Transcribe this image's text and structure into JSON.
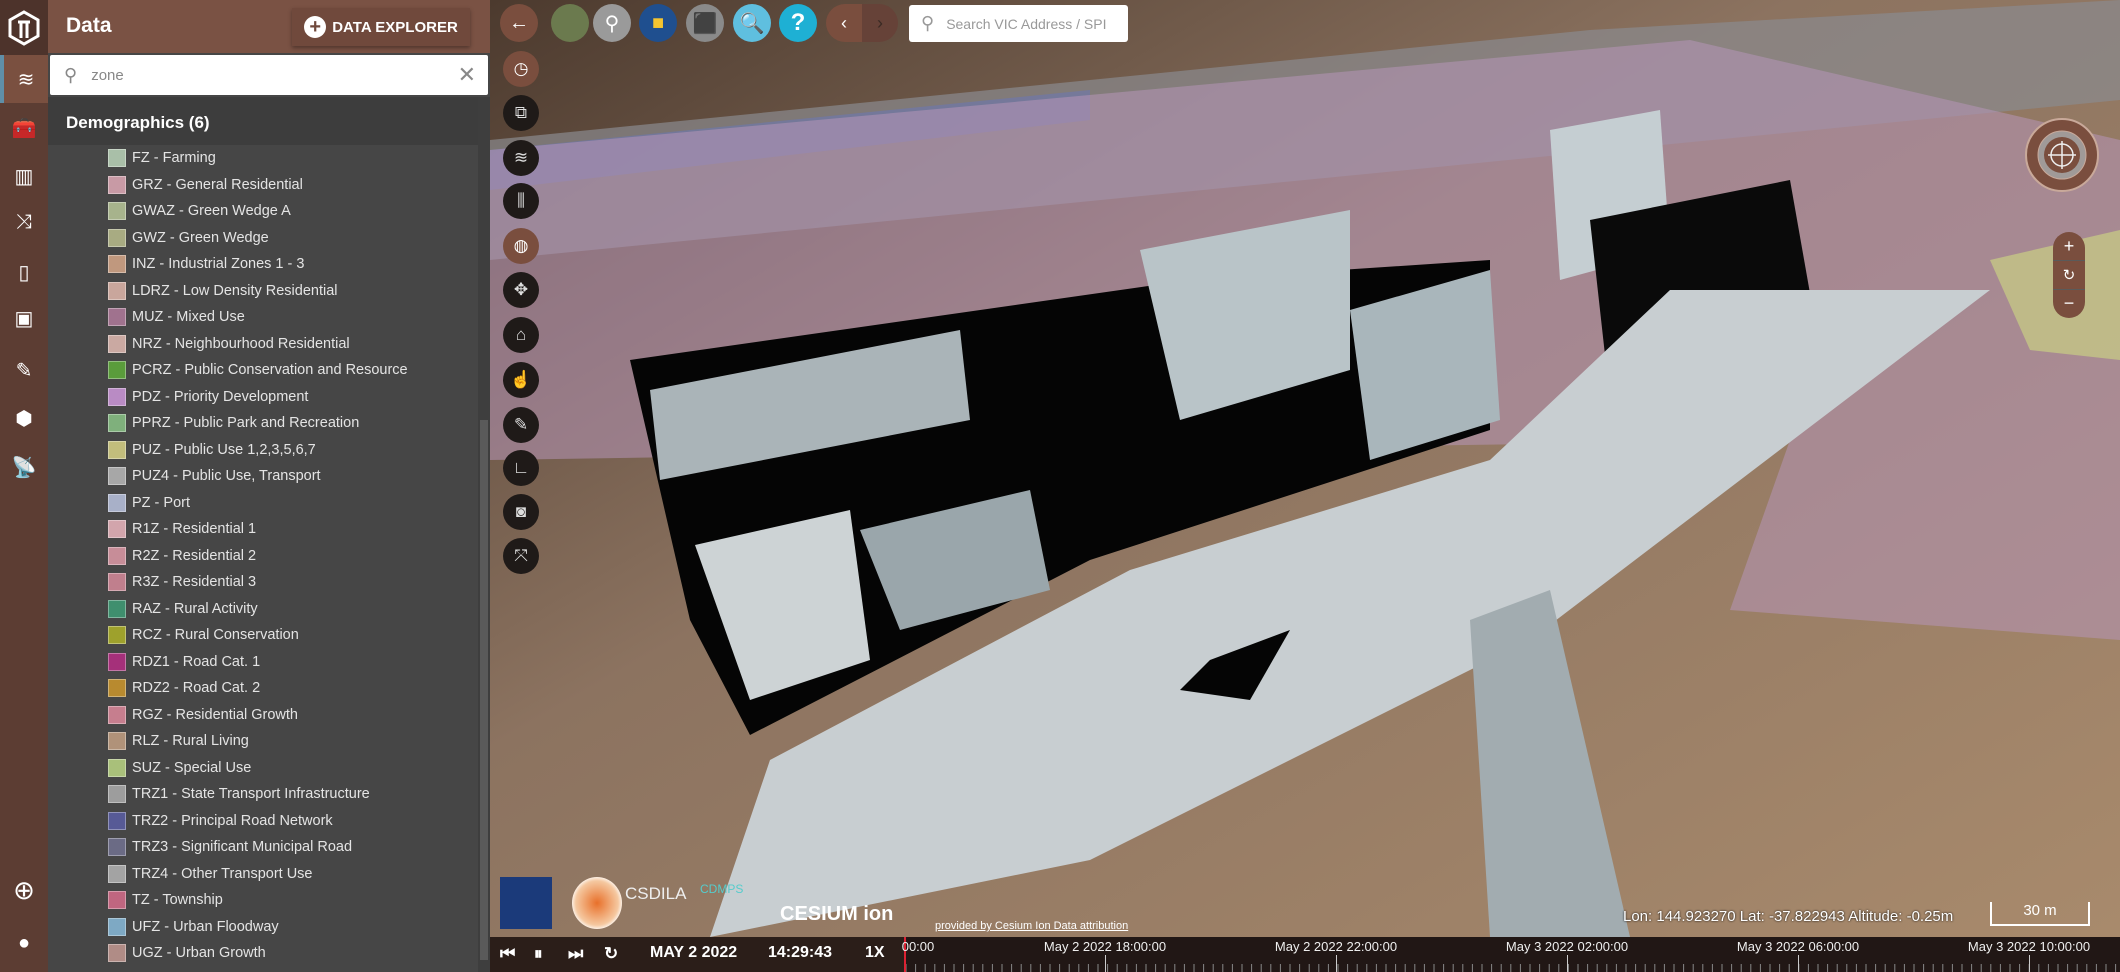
{
  "sidebar": {
    "active": "data",
    "items": [
      "database-icon",
      "toolbox-icon",
      "buildings-icon",
      "shuffle-icon",
      "building-icon",
      "boxes-icon",
      "ruler-pencil-icon",
      "cubes-icon",
      "satellite-icon"
    ],
    "bottom": [
      "plus-icon",
      "user-icon"
    ]
  },
  "panel": {
    "title": "Data",
    "explorer_label": "DATA EXPLORER",
    "search_value": "zone",
    "category": "Demographics (6)",
    "items": [
      {
        "label": "FZ - Farming",
        "color": "#a9bfa8"
      },
      {
        "label": "GRZ - General Residential",
        "color": "#c89aa5"
      },
      {
        "label": "GWAZ - Green Wedge A",
        "color": "#a7b38c"
      },
      {
        "label": "GWZ - Green Wedge",
        "color": "#a8ab82"
      },
      {
        "label": "INZ - Industrial Zones 1 - 3",
        "color": "#c0987e"
      },
      {
        "label": "LDRZ - Low Density Residential",
        "color": "#c9a69c"
      },
      {
        "label": "MUZ - Mixed Use",
        "color": "#a0728e"
      },
      {
        "label": "NRZ - Neighbourhood Residential",
        "color": "#caa9a2"
      },
      {
        "label": "PCRZ - Public Conservation and Resource",
        "color": "#5a9c3b"
      },
      {
        "label": "PDZ - Priority Development",
        "color": "#b98bc4"
      },
      {
        "label": "PPRZ - Public Park and Recreation",
        "color": "#7fb07c"
      },
      {
        "label": "PUZ - Public Use 1,2,3,5,6,7",
        "color": "#c2bd7c"
      },
      {
        "label": "PUZ4 - Public Use, Transport",
        "color": "#a7a7a7"
      },
      {
        "label": "PZ - Port",
        "color": "#a8b0c8"
      },
      {
        "label": "R1Z - Residential 1",
        "color": "#d2a5ac"
      },
      {
        "label": "R2Z - Residential 2",
        "color": "#c78d98"
      },
      {
        "label": "R3Z - Residential 3",
        "color": "#c07f8d"
      },
      {
        "label": "RAZ - Rural Activity",
        "color": "#3f8f6e"
      },
      {
        "label": "RCZ - Rural Conservation",
        "color": "#9ea12c"
      },
      {
        "label": "RDZ1 - Road Cat. 1",
        "color": "#a5307a"
      },
      {
        "label": "RDZ2 - Road Cat. 2",
        "color": "#b88a2f"
      },
      {
        "label": "RGZ - Residential Growth",
        "color": "#c67e8e"
      },
      {
        "label": "RLZ - Rural Living",
        "color": "#b09279"
      },
      {
        "label": "SUZ - Special Use",
        "color": "#a9c07a"
      },
      {
        "label": "TRZ1 - State Transport Infrastructure",
        "color": "#9d9d9d"
      },
      {
        "label": "TRZ2 - Principal Road Network",
        "color": "#575a96"
      },
      {
        "label": "TRZ3 - Significant Municipal Road",
        "color": "#6b6b85"
      },
      {
        "label": "TRZ4 - Other Transport Use",
        "color": "#a3a3a3"
      },
      {
        "label": "TZ - Township",
        "color": "#c06680"
      },
      {
        "label": "UFZ - Urban Floodway",
        "color": "#7ea9c4"
      },
      {
        "label": "UGZ - Urban Growth",
        "color": "#b08c86"
      }
    ]
  },
  "map": {
    "search_placeholder": "Search VIC Address / SPI",
    "toolbar": [
      "back-arrow-icon",
      "satellite-basemap-icon",
      "street-view-icon",
      "toolbox-icon",
      "3d-cube-icon",
      "globe-search-icon",
      "help-icon"
    ],
    "tools": [
      "clock-icon",
      "split-screen-icon",
      "layers-icon",
      "sliders-icon",
      "globe-icon",
      "move-icon",
      "home-icon",
      "pointer-icon",
      "ruler-pencil-icon",
      "measure-icon",
      "camera-icon",
      "fullscreen-icon"
    ],
    "status": "Lon: 144.923270 Lat: -37.822943 Altitude: -0.25m",
    "scale": "30 m",
    "attribution": "provided by Cesium Ion  Data attribution",
    "logos": {
      "csdila": "CSDILA",
      "cdmps": "CDMPS",
      "cesium": "CESIUM ion"
    }
  },
  "timeline": {
    "date": "MAY 2 2022",
    "time": "14:29:43",
    "speed": "1X",
    "partial_label": "00:00",
    "labels": [
      "May 2 2022 18:00:00",
      "May 2 2022 22:00:00",
      "May 3 2022 02:00:00",
      "May 3 2022 06:00:00",
      "May 3 2022 10:00:00"
    ]
  }
}
